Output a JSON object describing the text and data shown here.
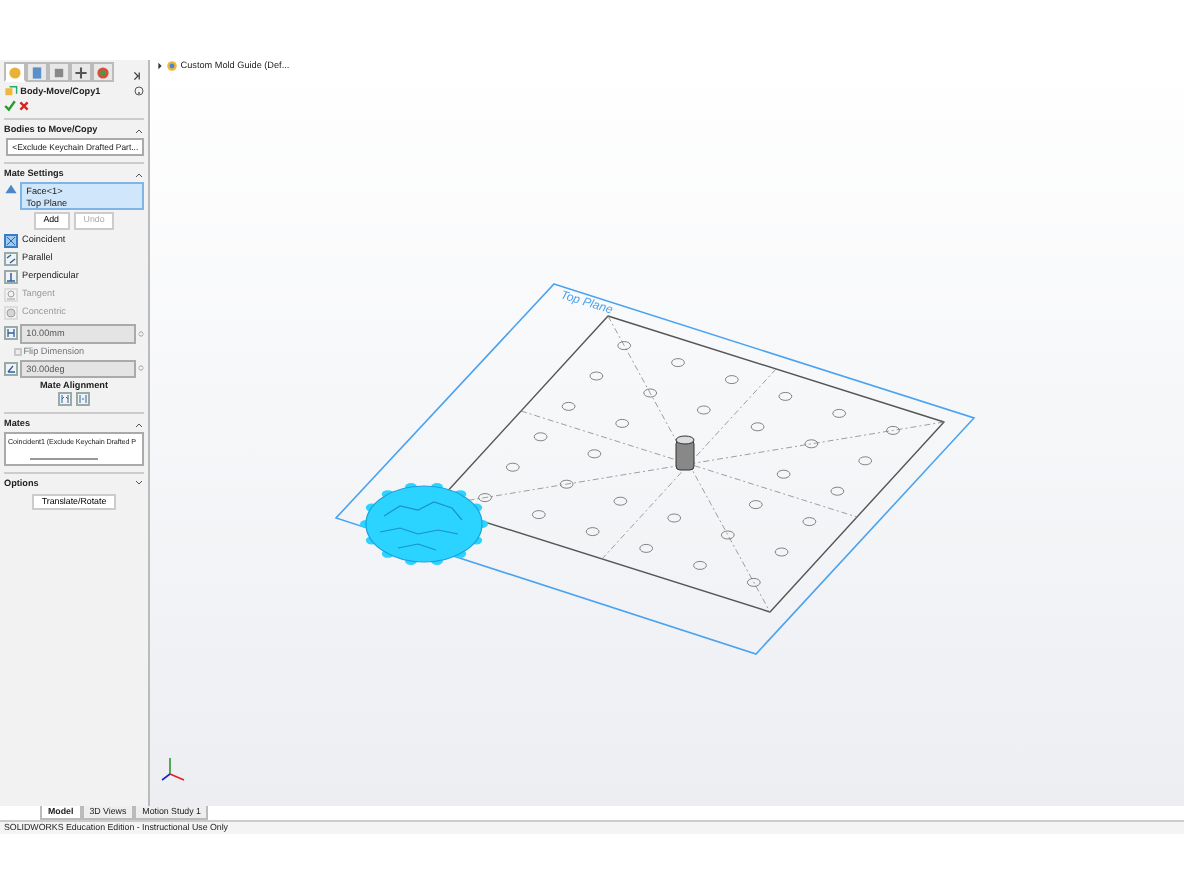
{
  "manager_tabs": [
    {
      "selected": true
    },
    {
      "selected": false
    },
    {
      "selected": false
    },
    {
      "selected": false
    },
    {
      "selected": false
    }
  ],
  "tree_root": {
    "label": "Custom Mold Guide (Def...",
    "expanded": false
  },
  "property_manager": {
    "title": "Body-Move/Copy1",
    "bodies_section": {
      "title": "Bodies to Move/Copy",
      "expanded": true,
      "value": "<Exclude Keychain Drafted Part..."
    },
    "mate_settings": {
      "title": "Mate Settings",
      "expanded": true,
      "entities": [
        "Face<1>",
        "Top Plane"
      ],
      "buttons": [
        {
          "label": "Add",
          "disabled": false
        },
        {
          "label": "Undo",
          "disabled": true
        }
      ],
      "mate_types": [
        {
          "kind": "coincident",
          "label": "Coincident",
          "selected": true,
          "disabled": false
        },
        {
          "kind": "parallel",
          "label": "Parallel",
          "selected": false,
          "disabled": false
        },
        {
          "kind": "perpendicular",
          "label": "Perpendicular",
          "selected": false,
          "disabled": false
        },
        {
          "kind": "tangent",
          "label": "Tangent",
          "selected": false,
          "disabled": true
        },
        {
          "kind": "concentric",
          "label": "Concentric",
          "selected": false,
          "disabled": true
        }
      ],
      "distance": {
        "value": "10.00mm",
        "disabled": true
      },
      "flip_dimension": {
        "label": "Flip Dimension",
        "checked": false,
        "disabled": true
      },
      "angle": {
        "value": "30.00deg",
        "disabled": true
      },
      "alignment_label": "Mate Alignment"
    },
    "mates_section": {
      "title": "Mates",
      "expanded": true,
      "items": [
        "Coincident1 (Exclude Keychain Drafted P"
      ]
    },
    "options_section": {
      "title": "Options",
      "expanded": false
    },
    "action_button": "Translate/Rotate"
  },
  "graphics": {
    "plane_label": "Top Plane"
  },
  "bottom_tabs": [
    {
      "label": "Model",
      "selected": true
    },
    {
      "label": "3D Views",
      "selected": false
    },
    {
      "label": "Motion Study 1",
      "selected": false
    }
  ],
  "status_bar": "SOLIDWORKS Education Edition - Instructional Use Only"
}
